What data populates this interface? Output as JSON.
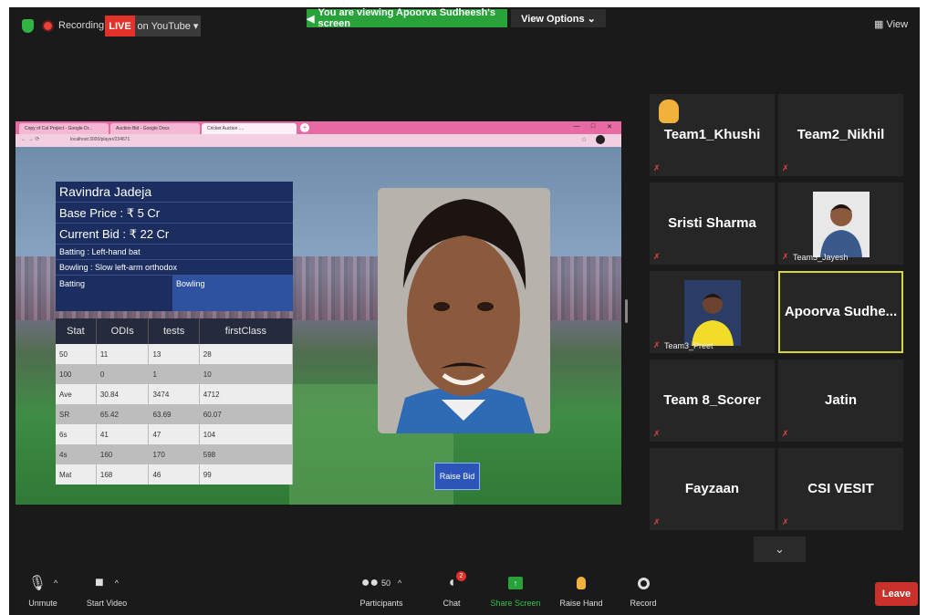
{
  "topbar": {
    "recording_label": "Recording",
    "live_label": "LIVE",
    "youtube_label": "on YouTube ▾",
    "viewing_banner": "You are viewing Apoorva Sudheesh's screen",
    "view_options_label": "View Options ⌄",
    "view_label": "View"
  },
  "shared": {
    "tabs": [
      "Copy of Cal Project - Google Dr...",
      "Auction Bid - Google Docs",
      "Cricket Auction ...."
    ],
    "url": "localhost:3000/player/234671",
    "player": {
      "name": "Ravindra Jadeja",
      "base_price": "Base Price : ₹ 5 Cr",
      "current_bid": "Current Bid : ₹ 22 Cr",
      "batting": "Batting : Left-hand bat",
      "bowling": "Bowling : Slow left-arm orthodox",
      "tab_batting": "Batting",
      "tab_bowling": "Bowling"
    },
    "stats": {
      "headers": [
        "Stat",
        "ODIs",
        "tests",
        "firstClass"
      ],
      "rows": [
        [
          "50",
          "11",
          "13",
          "28"
        ],
        [
          "100",
          "0",
          "1",
          "10"
        ],
        [
          "Ave",
          "30.84",
          "3474",
          "4712"
        ],
        [
          "SR",
          "65.42",
          "63.69",
          "60.07"
        ],
        [
          "6s",
          "41",
          "47",
          "104"
        ],
        [
          "4s",
          "160",
          "170",
          "598"
        ],
        [
          "Mat",
          "168",
          "46",
          "99"
        ]
      ]
    },
    "raise_bid_label": "Raise Bid"
  },
  "participants": [
    {
      "name": "Team1_Khushi",
      "hand": true
    },
    {
      "name": "Team2_Nikhil"
    },
    {
      "name": "Sristi Sharma"
    },
    {
      "label": "Team3_Jayesh",
      "video": true
    },
    {
      "label": "Team3_Preet",
      "video": true
    },
    {
      "name": "Apoorva  Sudhe...",
      "active": true
    },
    {
      "name": "Team 8_Scorer"
    },
    {
      "name": "Jatin"
    },
    {
      "name": "Fayzaan"
    },
    {
      "name": "CSI VESIT"
    }
  ],
  "toolbar": {
    "unmute": "Unmute",
    "start_video": "Start Video",
    "participants": "Participants",
    "participants_count": "50",
    "chat": "Chat",
    "chat_badge": "2",
    "share_screen": "Share Screen",
    "raise_hand": "Raise Hand",
    "record": "Record",
    "leave": "Leave"
  },
  "colors": {
    "accent_green": "#27a33a",
    "live_red": "#e4322b",
    "active_speaker_border": "#d5d63a",
    "leave_red": "#c8322a"
  }
}
